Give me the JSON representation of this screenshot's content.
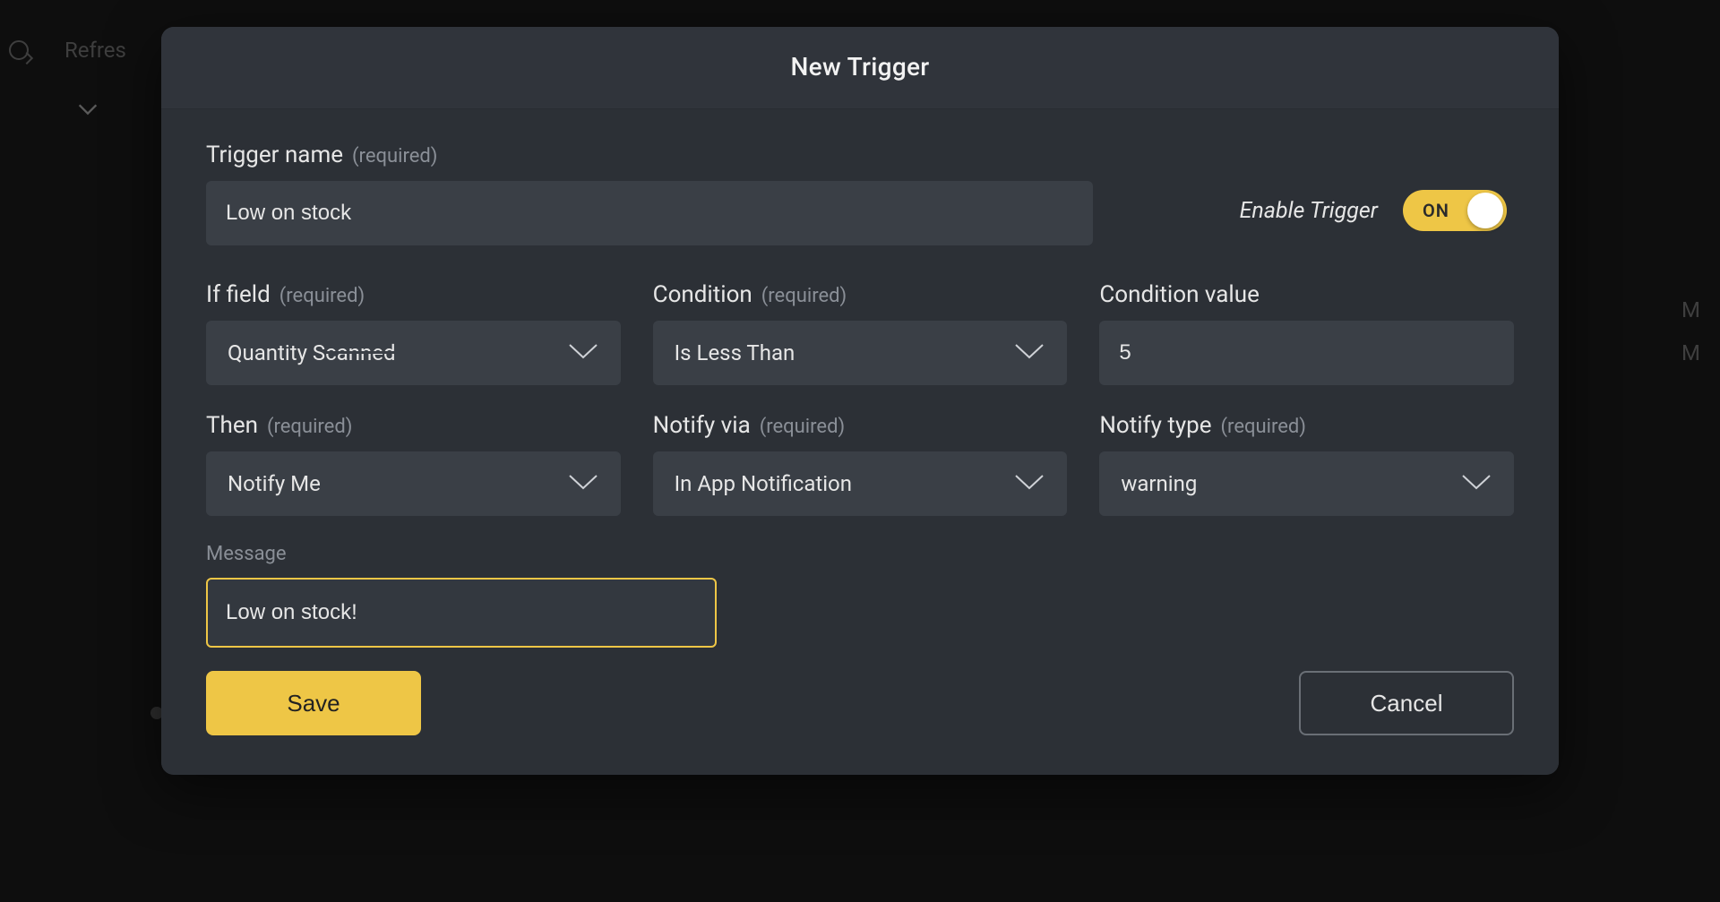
{
  "background": {
    "refresh_label": "Refres",
    "side_stub_a": "M",
    "side_stub_b": "M"
  },
  "modal": {
    "title": "New Trigger",
    "name": {
      "label": "Trigger name",
      "required": "(required)",
      "value": "Low on stock"
    },
    "enable": {
      "label": "Enable Trigger",
      "state_text": "ON",
      "value": true
    },
    "if_field": {
      "label": "If field",
      "required": "(required)",
      "value": "Quantity Scanned"
    },
    "condition": {
      "label": "Condition",
      "required": "(required)",
      "value": "Is Less Than"
    },
    "condition_value": {
      "label": "Condition value",
      "value": "5"
    },
    "then": {
      "label": "Then",
      "required": "(required)",
      "value": "Notify Me"
    },
    "notify_via": {
      "label": "Notify via",
      "required": "(required)",
      "value": "In App Notification"
    },
    "notify_type": {
      "label": "Notify type",
      "required": "(required)",
      "value": "warning"
    },
    "message": {
      "label": "Message",
      "value": "Low on stock!"
    },
    "buttons": {
      "save": "Save",
      "cancel": "Cancel"
    }
  }
}
